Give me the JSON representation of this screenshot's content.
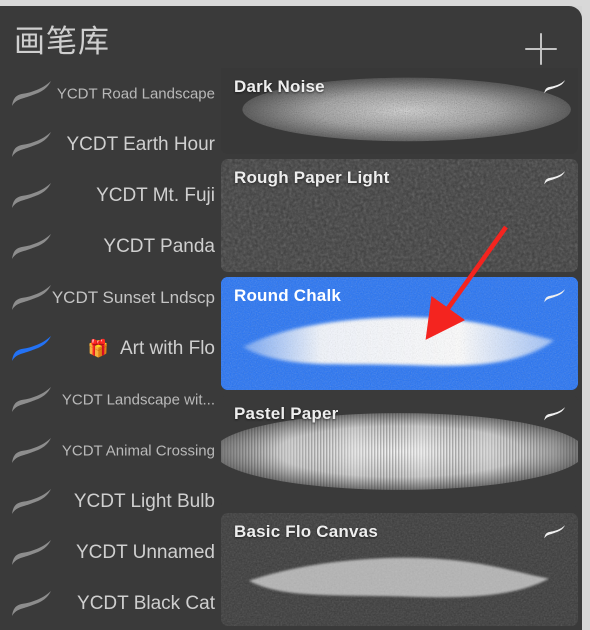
{
  "window": {
    "title": "画笔库",
    "add_button_label": "+",
    "accent_color": "#2372f5",
    "panel_color": "#3a3a3a",
    "annotation_color": "#f4241f"
  },
  "sidebar": {
    "name": "brush-set-list",
    "items": [
      {
        "label": "YCDT Road Landscape",
        "size": "sm",
        "selected": false,
        "emoji": ""
      },
      {
        "label": "YCDT Earth Hour",
        "size": "lg",
        "selected": false,
        "emoji": ""
      },
      {
        "label": "YCDT Mt. Fuji",
        "size": "lg",
        "selected": false,
        "emoji": ""
      },
      {
        "label": "YCDT Panda",
        "size": "lg",
        "selected": false,
        "emoji": ""
      },
      {
        "label": "YCDT Sunset Lndscp",
        "size": "md",
        "selected": false,
        "emoji": ""
      },
      {
        "label": "Art with Flo",
        "size": "lg",
        "selected": true,
        "emoji": "🎁"
      },
      {
        "label": "YCDT Landscape wit...",
        "size": "sm",
        "selected": false,
        "emoji": ""
      },
      {
        "label": "YCDT Animal Crossing",
        "size": "sm",
        "selected": false,
        "emoji": ""
      },
      {
        "label": "YCDT Light Bulb",
        "size": "lg",
        "selected": false,
        "emoji": ""
      },
      {
        "label": "YCDT Unnamed",
        "size": "lg",
        "selected": false,
        "emoji": ""
      },
      {
        "label": "YCDT Black Cat",
        "size": "lg",
        "selected": false,
        "emoji": ""
      }
    ]
  },
  "brushes": {
    "name": "brush-card-list",
    "items": [
      {
        "label": "Dark Noise",
        "selected": false,
        "style": "dark-noise",
        "height": 106,
        "clipped_top": true
      },
      {
        "label": "Rough Paper Light",
        "selected": false,
        "style": "rough-paper-light",
        "height": 113
      },
      {
        "label": "Round Chalk",
        "selected": true,
        "style": "round-chalk",
        "height": 113
      },
      {
        "label": "Pastel Paper",
        "selected": false,
        "style": "pastel-paper",
        "height": 113
      },
      {
        "label": "Basic Flo Canvas",
        "selected": false,
        "style": "basic-flo-canvas",
        "height": 113
      }
    ]
  },
  "icons": {
    "add": "plus-icon",
    "brush_stroke": "brush-stroke-icon",
    "gift": "gift-icon",
    "annotation": "red-arrow-annotation"
  }
}
